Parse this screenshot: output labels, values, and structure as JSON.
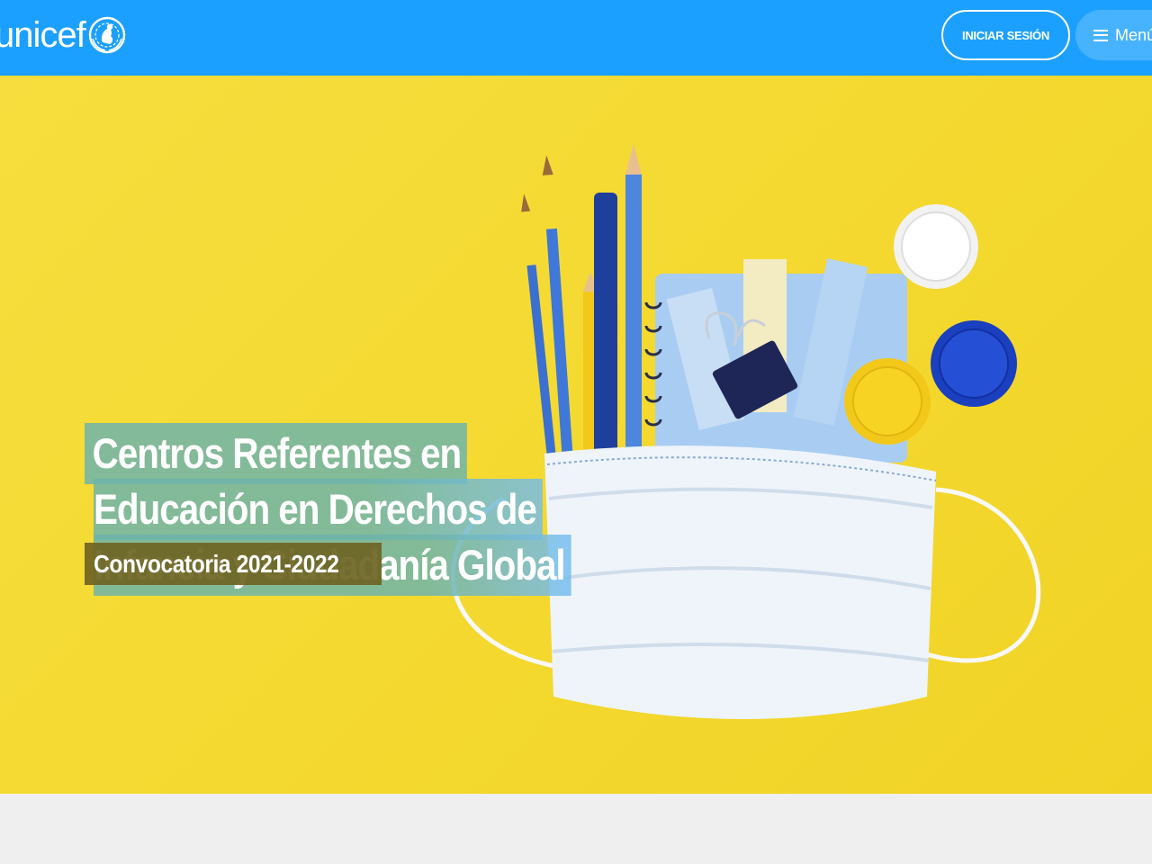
{
  "header": {
    "logo_text": "unicef",
    "logo_icon": "unicef-emblem-icon",
    "login_label": "INICIAR SESIÓN",
    "menu_label": "Menú",
    "menu_icon": "hamburger-icon",
    "bg_color": "#1ca0ff"
  },
  "hero": {
    "title_lines": [
      "Centros Referentes en",
      "Educación en Derechos de",
      "Infancia y Ciudadanía Global"
    ],
    "subtitle": "Convocatoria 2021-2022",
    "image_subject": "school supplies and face mask on yellow background",
    "bg_color": "#f4d930"
  }
}
